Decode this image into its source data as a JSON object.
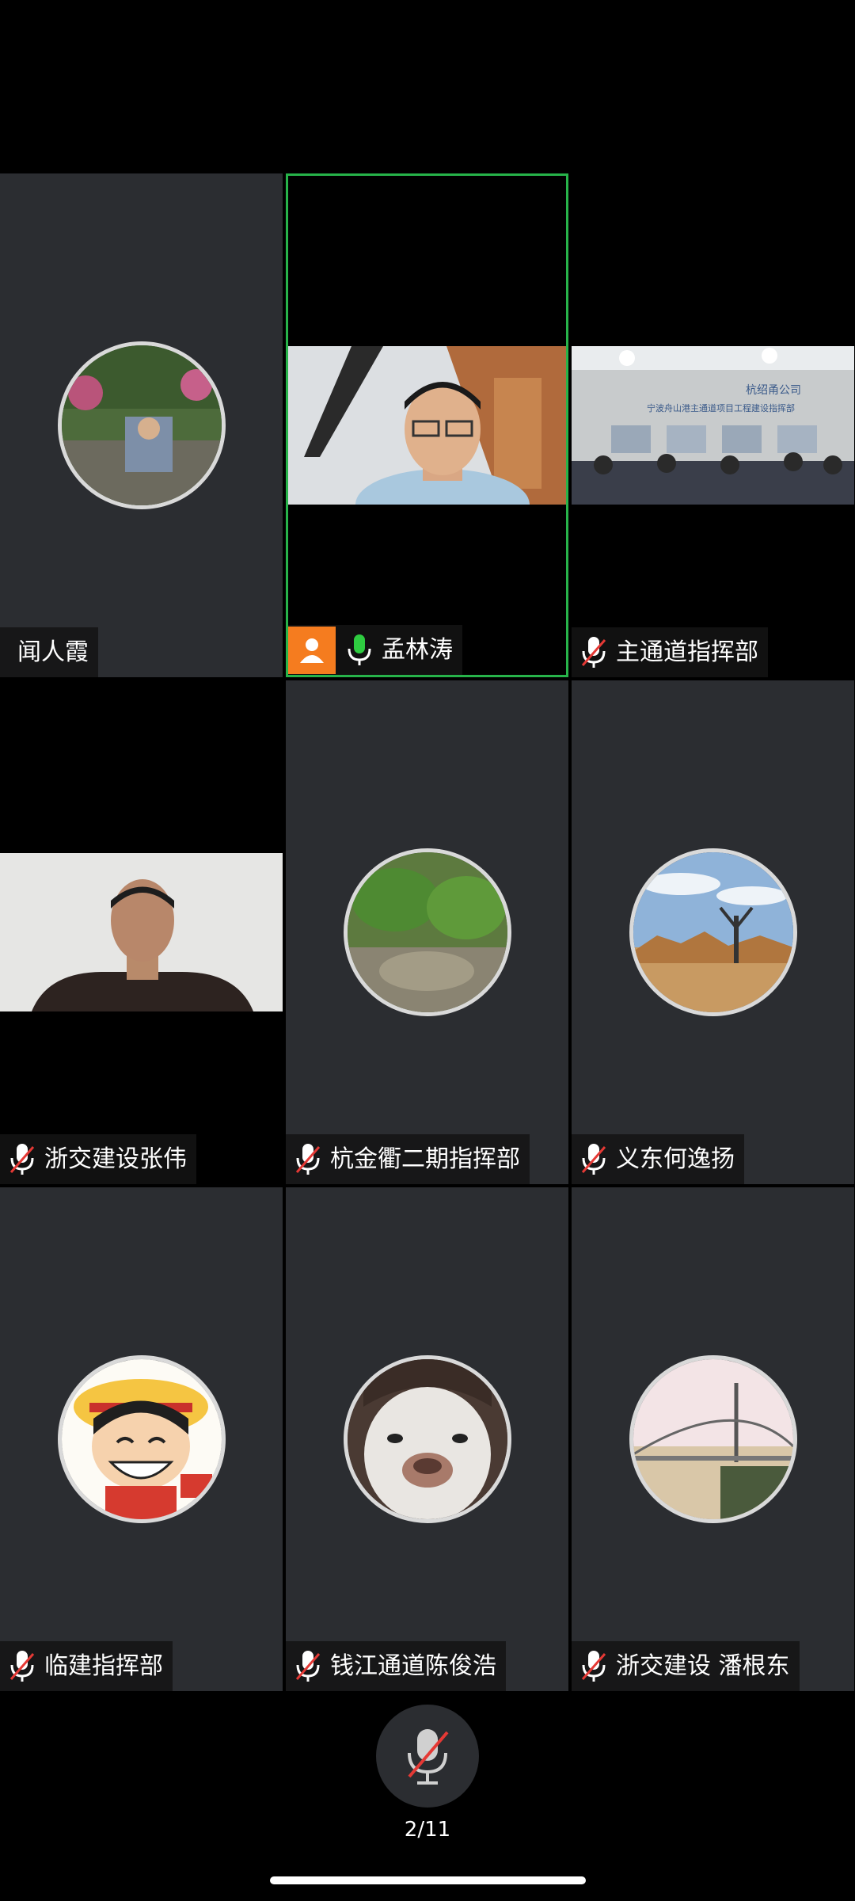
{
  "participants": [
    {
      "name": "闻人霞",
      "mic": "none",
      "view": "avatar"
    },
    {
      "name": "孟林涛",
      "mic": "on",
      "view": "video",
      "active": true
    },
    {
      "name": "主通道指挥部",
      "mic": "muted",
      "view": "video",
      "video_text": [
        "杭绍甬公司",
        "宁波舟山港主通道项目工程建设指挥部"
      ]
    },
    {
      "name": "浙交建设张伟",
      "mic": "muted",
      "view": "video"
    },
    {
      "name": "杭金衢二期指挥部",
      "mic": "muted",
      "view": "avatar"
    },
    {
      "name": "义东何逸扬",
      "mic": "muted",
      "view": "avatar"
    },
    {
      "name": "临建指挥部",
      "mic": "muted",
      "view": "avatar"
    },
    {
      "name": "钱江通道陈俊浩",
      "mic": "muted",
      "view": "avatar"
    },
    {
      "name": "浙交建设 潘根东",
      "mic": "muted",
      "view": "avatar"
    }
  ],
  "bottom": {
    "page_counter": "2/11"
  },
  "colors": {
    "active_border": "#27b34a",
    "badge": "#f57c1f",
    "mic_on": "#2ecc40",
    "mute_slash": "#e53935",
    "tile_bg": "#2b2d31"
  }
}
